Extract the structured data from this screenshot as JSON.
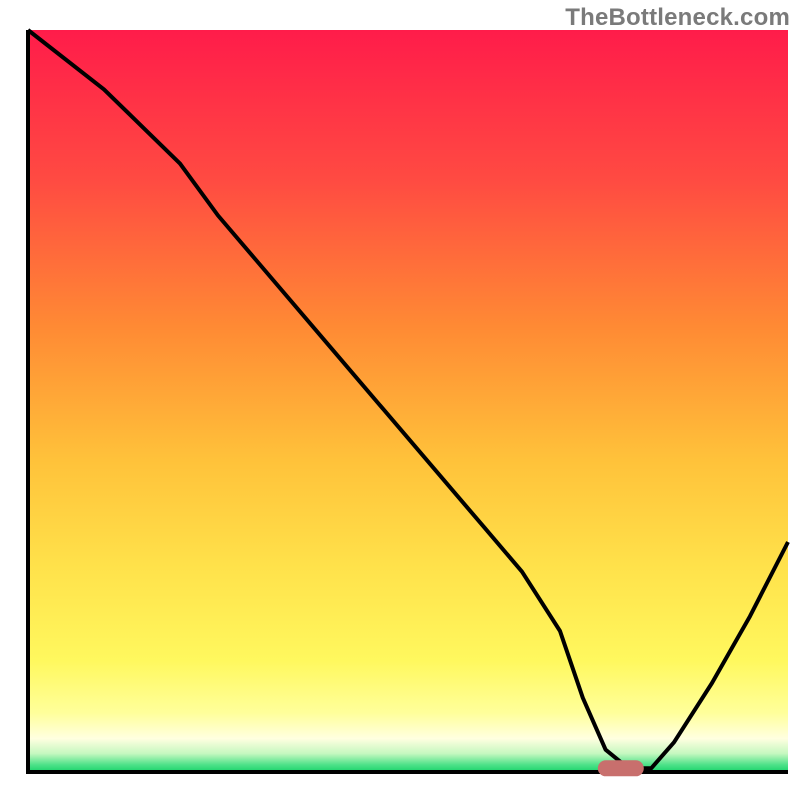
{
  "attribution": "TheBottleneck.com",
  "colors": {
    "axis": "#000000",
    "curve": "#000000",
    "marker": "#c86f6d",
    "gradient_stops": [
      {
        "offset": 0.0,
        "color": "#ff1c4a"
      },
      {
        "offset": 0.2,
        "color": "#ff4a42"
      },
      {
        "offset": 0.4,
        "color": "#ff8a34"
      },
      {
        "offset": 0.58,
        "color": "#ffc23a"
      },
      {
        "offset": 0.72,
        "color": "#ffe14a"
      },
      {
        "offset": 0.85,
        "color": "#fff85e"
      },
      {
        "offset": 0.92,
        "color": "#ffff9a"
      },
      {
        "offset": 0.955,
        "color": "#ffffe0"
      },
      {
        "offset": 0.975,
        "color": "#c6f8c0"
      },
      {
        "offset": 0.99,
        "color": "#4fe28a"
      },
      {
        "offset": 1.0,
        "color": "#18d36a"
      }
    ]
  },
  "chart_data": {
    "type": "line",
    "title": "",
    "xlabel": "",
    "ylabel": "",
    "xlim": [
      0,
      100
    ],
    "ylim": [
      0,
      100
    ],
    "x": [
      0,
      10,
      20,
      25,
      30,
      40,
      50,
      60,
      65,
      70,
      73,
      76,
      79,
      82,
      85,
      90,
      95,
      100
    ],
    "values": [
      100,
      92,
      82,
      75,
      69,
      57,
      45,
      33,
      27,
      19,
      10,
      3,
      0.5,
      0.5,
      4,
      12,
      21,
      31
    ],
    "marker": {
      "x": 78,
      "y": 0.5
    }
  }
}
